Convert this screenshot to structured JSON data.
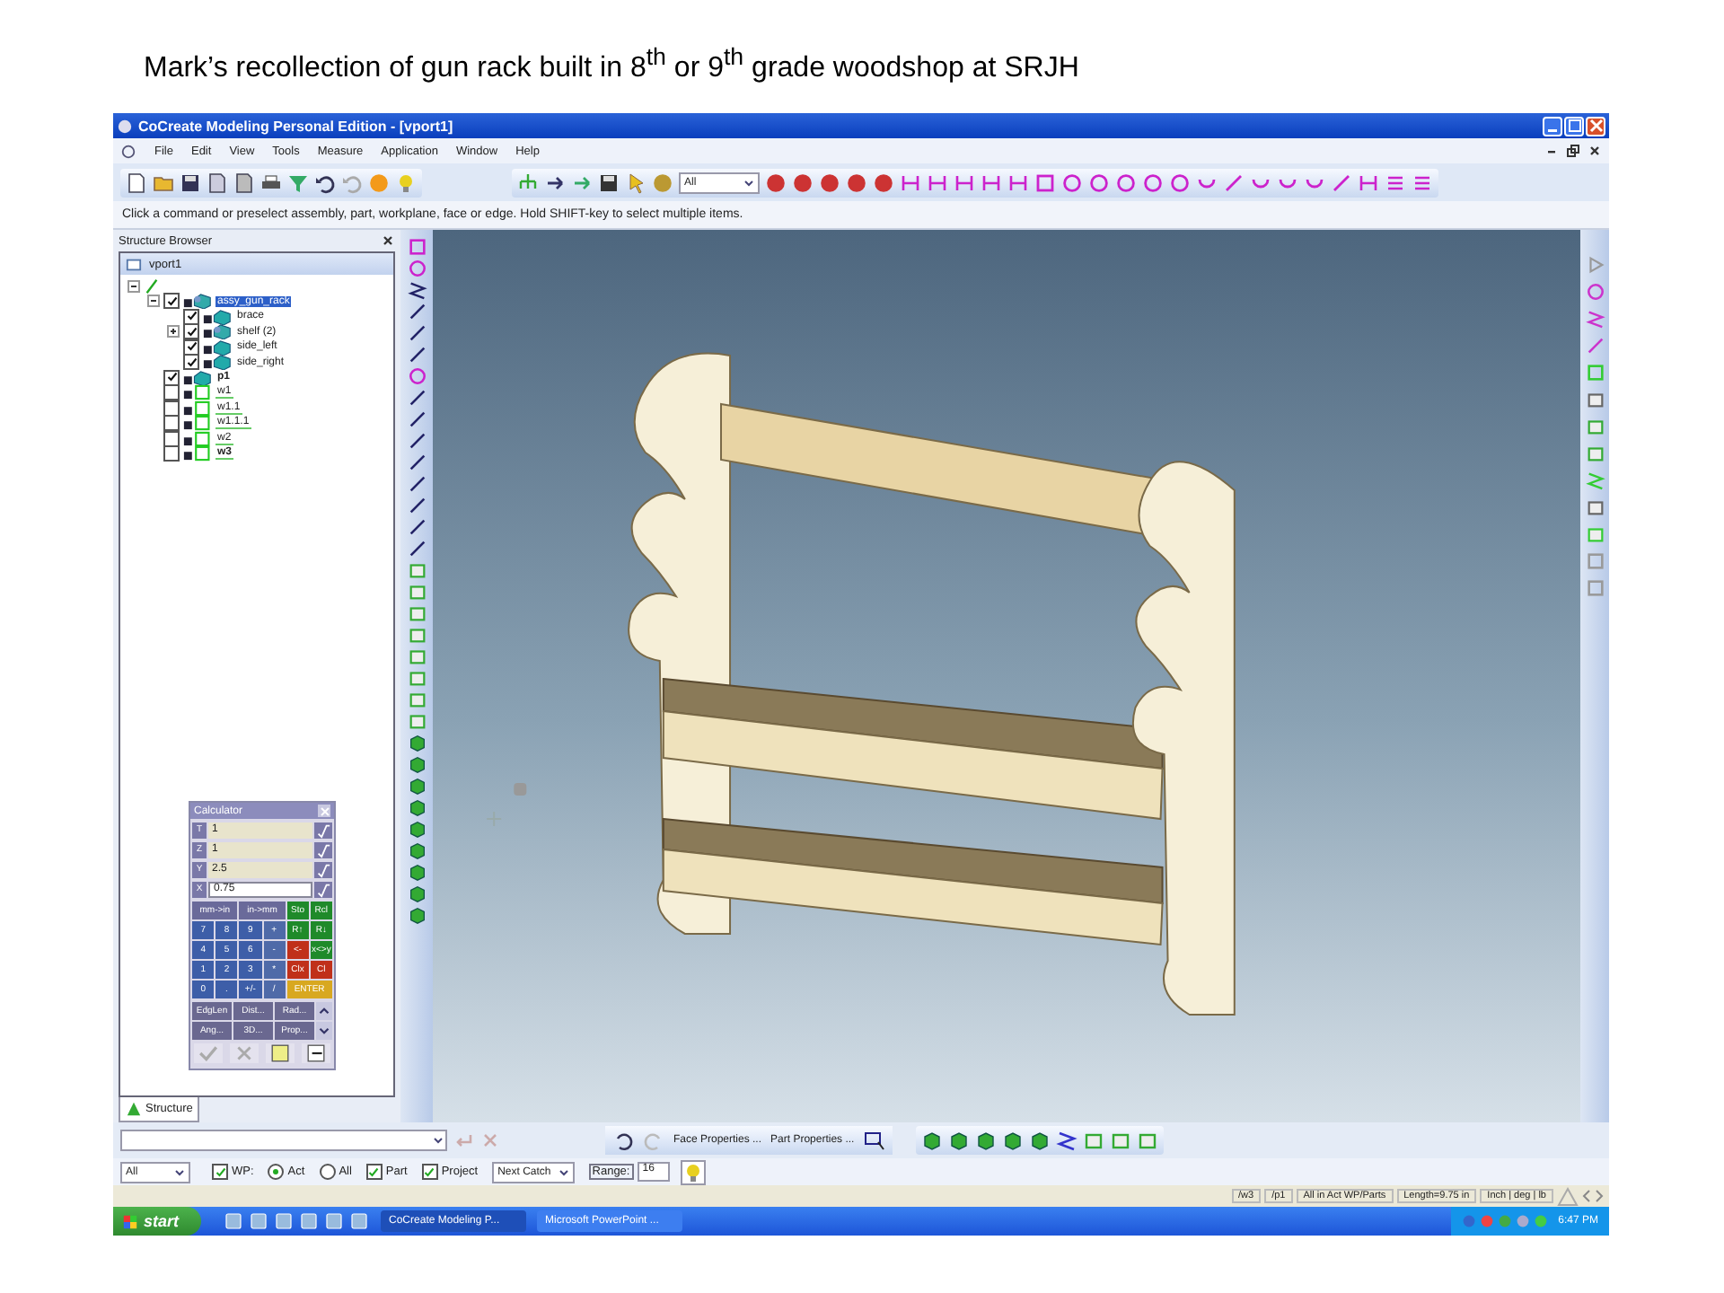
{
  "slide_title": "Mark’s recollection of gun rack built in 8$^{th}$ or 9$^{th}$ grade woodshop at SRJH",
  "window": {
    "title": "CoCreate Modeling Personal Edition - [vport1]"
  },
  "menu": [
    "File",
    "Edit",
    "View",
    "Tools",
    "Measure",
    "Application",
    "Window",
    "Help"
  ],
  "toolbar": {
    "filter_value": "All"
  },
  "prompt": "Click a command or preselect assembly, part, workplane, face or edge. Hold SHIFT-key to select multiple items.",
  "structure_browser": {
    "title": "Structure Browser",
    "viewport": "vport1",
    "tree": [
      {
        "kind": "root",
        "expanded": true,
        "children": [
          {
            "kind": "assembly",
            "label": "assy_gun_rack",
            "checked": true,
            "selected": true,
            "active": false,
            "expanded": true,
            "children": [
              {
                "kind": "part",
                "label": "brace",
                "checked": true,
                "selected": false,
                "active": false
              },
              {
                "kind": "assembly",
                "label": "shelf (2)",
                "checked": true,
                "selected": false,
                "active": false,
                "expanded": false
              },
              {
                "kind": "part",
                "label": "side_left",
                "checked": true,
                "selected": false,
                "active": false
              },
              {
                "kind": "part",
                "label": "side_right",
                "checked": true,
                "selected": false,
                "active": false
              }
            ]
          },
          {
            "kind": "part",
            "label": "p1",
            "checked": true,
            "selected": false,
            "active": true
          },
          {
            "kind": "workplane",
            "label": "w1",
            "checked": false,
            "selected": false,
            "active": false
          },
          {
            "kind": "workplane",
            "label": "w1.1",
            "checked": false,
            "selected": false,
            "active": false
          },
          {
            "kind": "workplane",
            "label": "w1.1.1",
            "checked": false,
            "selected": false,
            "active": false
          },
          {
            "kind": "workplane",
            "label": "w2",
            "checked": false,
            "selected": false,
            "active": false
          },
          {
            "kind": "workplane",
            "label": "w3",
            "checked": false,
            "selected": false,
            "active": true
          }
        ]
      }
    ],
    "tab": "Structure"
  },
  "calculator": {
    "title": "Calculator",
    "registers": [
      {
        "name": "T",
        "value": "1"
      },
      {
        "name": "Z",
        "value": "1"
      },
      {
        "name": "Y",
        "value": "2.5"
      },
      {
        "name": "X",
        "value": "0.75"
      }
    ],
    "keys": [
      {
        "label": "mm->in",
        "kind": "convert",
        "wide": true
      },
      {
        "label": "in->mm",
        "kind": "convert",
        "wide": true
      },
      {
        "label": "Sto",
        "kind": "memory",
        "wide": false
      },
      {
        "label": "Rcl",
        "kind": "memory",
        "wide": false
      },
      {
        "label": "7",
        "kind": "digit",
        "wide": false
      },
      {
        "label": "8",
        "kind": "digit",
        "wide": false
      },
      {
        "label": "9",
        "kind": "digit",
        "wide": false
      },
      {
        "label": "+",
        "kind": "operator",
        "wide": false
      },
      {
        "label": "R↑",
        "kind": "memory",
        "wide": false
      },
      {
        "label": "R↓",
        "kind": "memory",
        "wide": false
      },
      {
        "label": "4",
        "kind": "digit",
        "wide": false
      },
      {
        "label": "5",
        "kind": "digit",
        "wide": false
      },
      {
        "label": "6",
        "kind": "digit",
        "wide": false
      },
      {
        "label": "-",
        "kind": "operator",
        "wide": false
      },
      {
        "label": "<-",
        "kind": "clear",
        "wide": false
      },
      {
        "label": "x<>y",
        "kind": "memory",
        "wide": false
      },
      {
        "label": "1",
        "kind": "digit",
        "wide": false
      },
      {
        "label": "2",
        "kind": "digit",
        "wide": false
      },
      {
        "label": "3",
        "kind": "digit",
        "wide": false
      },
      {
        "label": "*",
        "kind": "operator",
        "wide": false
      },
      {
        "label": "Clx",
        "kind": "clear",
        "wide": false
      },
      {
        "label": "Cl",
        "kind": "clear",
        "wide": false
      },
      {
        "label": "0",
        "kind": "digit",
        "wide": false
      },
      {
        "label": ".",
        "kind": "digit",
        "wide": false
      },
      {
        "label": "+/-",
        "kind": "digit",
        "wide": false
      },
      {
        "label": "/",
        "kind": "operator",
        "wide": false
      },
      {
        "label": "ENTER",
        "kind": "enter",
        "wide": true
      }
    ],
    "commands": [
      "EdgLen",
      "Dist...",
      "Rad...",
      "Ang...",
      "3D...",
      "Prop..."
    ]
  },
  "properties": [
    "Face Properties ...",
    "Part Properties ..."
  ],
  "options": [
    {
      "kind": "dropdown",
      "value": "All"
    },
    {
      "kind": "checkbox",
      "label": "WP:",
      "checked": true
    },
    {
      "kind": "radio",
      "label": "Act",
      "selected": true
    },
    {
      "kind": "radio",
      "label": "All",
      "selected": false
    },
    {
      "kind": "checkbox",
      "label": "Part",
      "checked": true
    },
    {
      "kind": "checkbox",
      "label": "Project",
      "checked": true
    },
    {
      "kind": "dropdown",
      "value": "Next Catch"
    },
    {
      "kind": "field",
      "label": "Range:",
      "value": "16"
    }
  ],
  "status_bar": [
    "/w3",
    "/p1",
    "All in Act WP/Parts",
    "Length=9.75 in",
    "Inch | deg | lb"
  ],
  "taskbar": {
    "start": "start",
    "tasks": [
      {
        "label": "CoCreate Modeling P...",
        "selected": true
      },
      {
        "label": "Microsoft PowerPoint ...",
        "selected": false
      }
    ],
    "clock": "6:47 PM"
  }
}
